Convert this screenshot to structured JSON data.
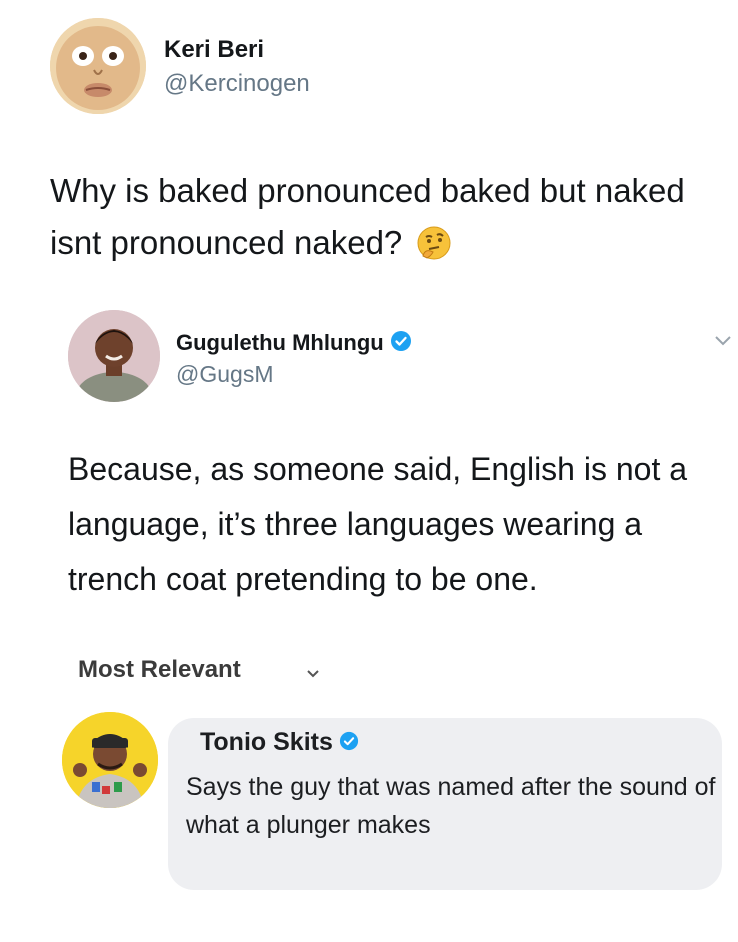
{
  "tweet1": {
    "name": "Keri Beri",
    "handle": "@Kercinogen",
    "text": "Why is baked pronounced baked but naked isnt pronounced naked?",
    "emoji_icon": "thinking-face-emoji"
  },
  "tweet2": {
    "name": "Gugulethu Mhlungu",
    "handle": "@GugsM",
    "verified": true,
    "text": "Because, as someone said, English is not a language, it’s three languages wearing a trench coat pretending to be one."
  },
  "sort": {
    "label": "Most Relevant"
  },
  "comment": {
    "name": "Tonio Skits",
    "verified": true,
    "text": "Says the guy that was named after the sound of what a plunger makes"
  },
  "colors": {
    "verified_blue": "#1da1f2",
    "bubble_bg": "#eeeff2",
    "handle_gray": "#657786"
  }
}
